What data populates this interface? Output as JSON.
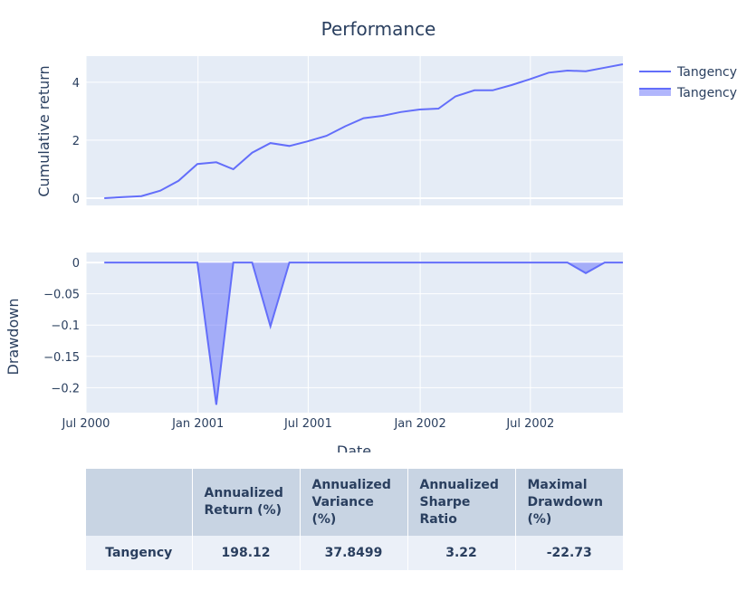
{
  "title": "Performance",
  "chart_data": [
    {
      "type": "line",
      "ylabel": "Cumulative return",
      "ylim": [
        -0.25,
        4.9
      ],
      "yticks": [
        0,
        2,
        4
      ],
      "series": [
        {
          "name": "Tangency",
          "color": "#636efa",
          "x": [
            "2000-07-31",
            "2000-08-31",
            "2000-09-30",
            "2000-10-31",
            "2000-11-30",
            "2000-12-31",
            "2001-01-31",
            "2001-02-28",
            "2001-03-31",
            "2001-04-30",
            "2001-05-31",
            "2001-06-30",
            "2001-07-31",
            "2001-08-31",
            "2001-09-30",
            "2001-10-31",
            "2001-11-30",
            "2001-12-31",
            "2002-01-31",
            "2002-02-28",
            "2002-03-31",
            "2002-04-30",
            "2002-05-31",
            "2002-06-30",
            "2002-07-31",
            "2002-08-31",
            "2002-09-30",
            "2002-10-31",
            "2002-11-30"
          ],
          "y": [
            0.0,
            0.04,
            0.07,
            0.26,
            0.6,
            1.18,
            1.24,
            1.0,
            1.57,
            1.9,
            1.8,
            1.96,
            2.15,
            2.48,
            2.76,
            2.84,
            2.97,
            3.06,
            3.09,
            3.51,
            3.72,
            3.72,
            3.9,
            4.1,
            4.33,
            4.4,
            4.38,
            4.5,
            4.62
          ]
        }
      ]
    },
    {
      "type": "area",
      "xlabel": "Date",
      "ylabel": "Drawdown",
      "ylim": [
        -0.24,
        0.016
      ],
      "yticks": [
        0,
        -0.05,
        -0.1,
        -0.15,
        -0.2
      ],
      "ytick_labels": [
        "0",
        "−0.05",
        "−0.1",
        "−0.15",
        "−0.2"
      ],
      "xticks": [
        "2000-07-01",
        "2001-01-01",
        "2001-07-01",
        "2002-01-01",
        "2002-07-01"
      ],
      "xtick_labels": [
        "Jul 2000",
        "Jan 2001",
        "Jul 2001",
        "Jan 2002",
        "Jul 2002"
      ],
      "series": [
        {
          "name": "Tangency",
          "color": "#636efa",
          "fill": "rgba(99,110,250,0.5)",
          "x": [
            "2000-07-31",
            "2000-08-31",
            "2000-09-30",
            "2000-10-31",
            "2000-11-30",
            "2000-12-31",
            "2001-01-31",
            "2001-02-28",
            "2001-03-31",
            "2001-04-30",
            "2001-05-31",
            "2001-06-30",
            "2001-07-31",
            "2001-08-31",
            "2001-09-30",
            "2001-10-31",
            "2001-11-30",
            "2001-12-31",
            "2002-01-31",
            "2002-02-28",
            "2002-03-31",
            "2002-04-30",
            "2002-05-31",
            "2002-06-30",
            "2002-07-31",
            "2002-08-31",
            "2002-09-30",
            "2002-10-31",
            "2002-11-30"
          ],
          "y": [
            0,
            0,
            0,
            0,
            0,
            0,
            -0.2273,
            0,
            0,
            -0.102,
            0,
            0,
            0,
            0,
            0,
            0,
            0,
            0,
            0,
            0,
            0,
            0,
            0,
            0,
            0,
            0,
            -0.017,
            0,
            0
          ]
        }
      ]
    }
  ],
  "legend": [
    "Tangency",
    "Tangency"
  ],
  "xrange": [
    "2000-07-01",
    "2002-11-30"
  ],
  "table": {
    "headers": [
      "",
      "Annualized Return (%)",
      "Annualized Variance (%)",
      "Annualized Sharpe Ratio",
      "Maximal Drawdown (%)"
    ],
    "rows": [
      [
        "Tangency",
        "198.12",
        "37.8499",
        "3.22",
        "-22.73"
      ]
    ]
  }
}
